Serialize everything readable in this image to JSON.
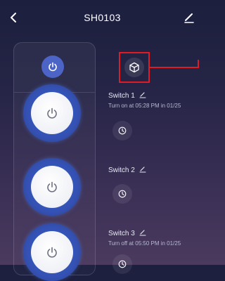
{
  "header": {
    "title": "SH0103"
  },
  "icons": {
    "back": "chevron-left-icon",
    "edit": "pencil-icon",
    "master_power": "power-icon",
    "scene": "cube-icon",
    "timer": "clock-icon"
  },
  "switches": [
    {
      "name": "Switch 1",
      "status": "Turn on at 05:28 PM in 01/25"
    },
    {
      "name": "Switch 2",
      "status": ""
    },
    {
      "name": "Switch 3",
      "status": "Turn off at 05:50 PM in 01/25"
    }
  ],
  "colors": {
    "accent_blue": "#4c64c6",
    "highlight_red": "#e01b24"
  }
}
